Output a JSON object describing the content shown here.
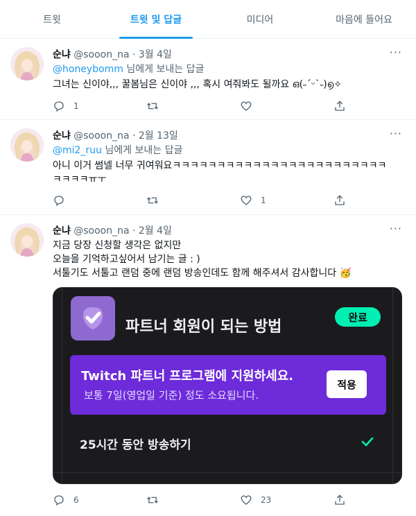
{
  "tabs": [
    {
      "label": "트윗"
    },
    {
      "label": "트윗 및 답글"
    },
    {
      "label": "미디어"
    },
    {
      "label": "마음에 들어요"
    }
  ],
  "tweets": [
    {
      "name": "순냐",
      "meta": "@sooon_na · 3월 4일",
      "more": "···",
      "mention": "@honeybomm",
      "reply_suffix": " 님에게 보내는 답글",
      "lines": [
        "그녀는 신이야,,, 꿀봄님은 신이야 ,,, 혹시 여줘봐도 될까요 ഒ(˶ˊᵕˋ˵)൭✧"
      ],
      "replies": "1",
      "retweets": "",
      "likes": "",
      "share": ""
    },
    {
      "name": "순냐",
      "meta": "@sooon_na · 2월 13일",
      "more": "···",
      "mention": "@mi2_ruu",
      "reply_suffix": " 님에게 보내는 답글",
      "lines": [
        "아니 이거 썸넬 너무 귀여워요ㅋㅋㅋㅋㅋㅋㅋㅋㅋㅋㅋㅋㅋㅋㅋㅋㅋㅋㅋㅋㅋㅋㅋㅋ",
        "ㅋㅋㅋㅋㅠㅜ"
      ],
      "replies": "",
      "retweets": "",
      "likes": "1",
      "share": ""
    },
    {
      "name": "순냐",
      "meta": "@sooon_na · 2월 4일",
      "more": "···",
      "lines": [
        "지금 당장 신청할 생각은 없지만",
        "오늘을 기억하고싶어서 남기는 글 : )",
        "서툴기도 서툴고 랜덤 중에 랜덤 방송인데도 함께 해주셔서 감사합니다 🥳"
      ],
      "replies": "6",
      "retweets": "",
      "likes": "23",
      "share": ""
    }
  ],
  "card": {
    "title": "파트너 회원이 되는 방법",
    "badge": "완료",
    "program_title": "Twitch 파트너 프로그램에 지원하세요.",
    "program_sub": "보통 7일(영업일 기준) 정도 소요됩니다.",
    "apply": "적용",
    "task": "25시간 동안 방송하기"
  },
  "colors": {
    "accent": "#1d9bf0",
    "twitch_purple": "#6d2bd9",
    "complete_green": "#00f0b4"
  }
}
